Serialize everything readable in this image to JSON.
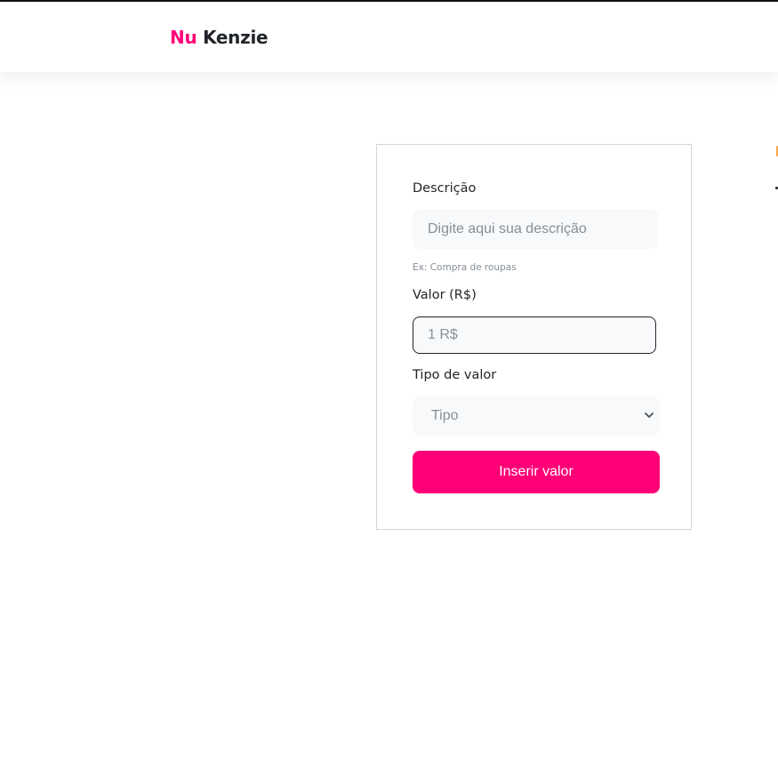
{
  "header": {
    "logo_primary": "Nu",
    "logo_secondary": "Kenzie"
  },
  "form": {
    "description": {
      "label": "Descrição",
      "placeholder": "Digite aqui sua descrição",
      "value": "",
      "hint": "Ex: Compra de roupas"
    },
    "amount": {
      "label": "Valor (R$)",
      "placeholder": "1 R$",
      "value": ""
    },
    "type": {
      "label": "Tipo de valor",
      "selected": "Tipo"
    },
    "submit_label": "Inserir valor"
  },
  "colors": {
    "brand": "#FF0077",
    "text": "#212529",
    "input_bg": "#F8F9FA",
    "muted": "#868E96"
  },
  "icons": {
    "select_arrow": "chevron-down-icon"
  }
}
